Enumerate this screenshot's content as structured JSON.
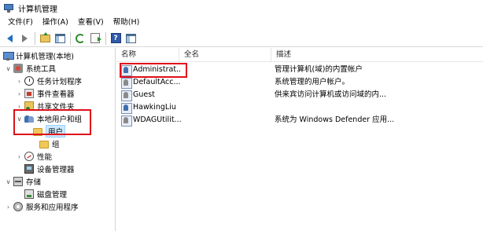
{
  "window": {
    "title": "计算机管理"
  },
  "menu": [
    "文件(F)",
    "操作(A)",
    "查看(V)",
    "帮助(H)"
  ],
  "toolbar": {
    "buttons": [
      "back-arrow-icon",
      "forward-arrow-icon",
      "up-folder-icon",
      "show-hide-tree-icon",
      "refresh-icon",
      "export-list-icon",
      "help-icon",
      "properties-pane-icon"
    ]
  },
  "tree": {
    "root": "计算机管理(本地)",
    "system_tools": "系统工具",
    "task_scheduler": "任务计划程序",
    "event_viewer": "事件查看器",
    "shared_folders": "共享文件夹",
    "local_users_groups": "本地用户和组",
    "users": "用户",
    "groups": "组",
    "performance": "性能",
    "device_manager": "设备管理器",
    "storage": "存储",
    "disk_management": "磁盘管理",
    "services_apps": "服务和应用程序"
  },
  "list": {
    "columns": [
      "名称",
      "全名",
      "描述"
    ],
    "rows": [
      {
        "name": "Administrat...",
        "fullname": "",
        "description": "管理计算机(域)的内置帐户",
        "disabled": false
      },
      {
        "name": "DefaultAcc...",
        "fullname": "",
        "description": "系统管理的用户帐户。",
        "disabled": true
      },
      {
        "name": "Guest",
        "fullname": "",
        "description": "供来宾访问计算机或访问域的内...",
        "disabled": true
      },
      {
        "name": "HawkingLiu",
        "fullname": "",
        "description": "",
        "disabled": false
      },
      {
        "name": "WDAGUtilit...",
        "fullname": "",
        "description": "系统为 Windows Defender 应用...",
        "disabled": true
      }
    ]
  },
  "colors": {
    "highlight": "#e0101a",
    "selection": "#cce8ff"
  }
}
